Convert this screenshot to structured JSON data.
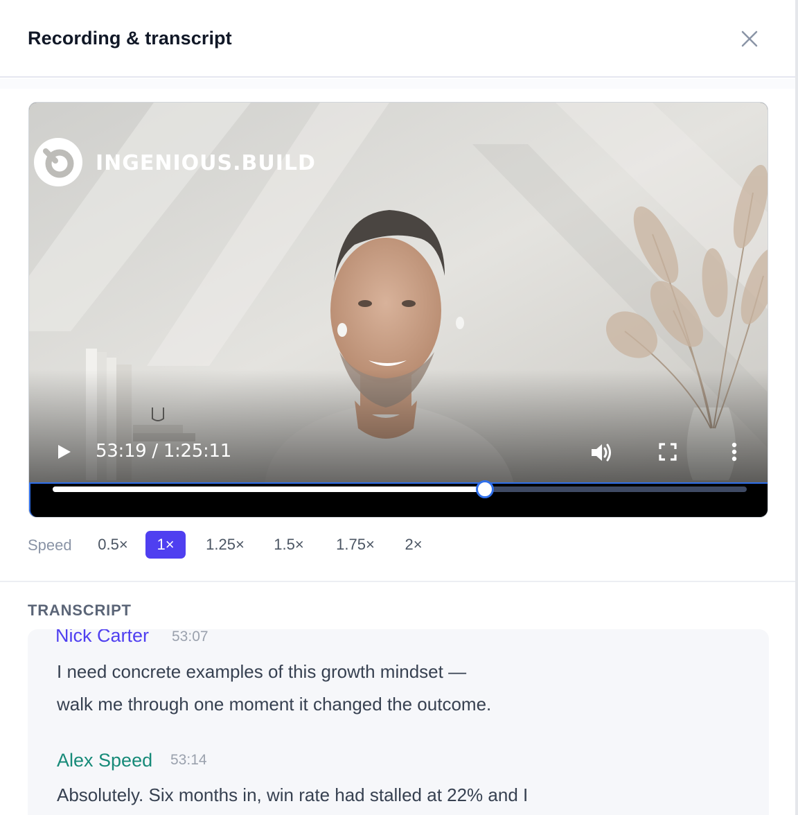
{
  "dialog": {
    "title": "Recording & transcript",
    "close_label": "close"
  },
  "player": {
    "brand_text": "INGENIOUS.BUILD",
    "current_time": "53:19",
    "duration": "1:25:11",
    "time_display": "53:19 / 1:25:11",
    "progress_fraction": 0.623,
    "is_playing": false,
    "icons": [
      "play-icon",
      "volume-icon",
      "fullscreen-icon",
      "more-vertical-icon"
    ]
  },
  "speed": {
    "label": "Speed",
    "options": [
      "0.5×",
      "1×",
      "1.25×",
      "1.5×",
      "1.75×",
      "2×"
    ],
    "selected": "1×"
  },
  "transcript": {
    "heading": "TRANSCRIPT",
    "entries": [
      {
        "speaker": "Nick Carter",
        "time": "53:07",
        "lines": [
          "I need concrete examples of this growth mindset —",
          "walk me through one moment it changed the outcome."
        ]
      },
      {
        "speaker": "Alex Speed",
        "time": "53:14",
        "lines": [
          "Absolutely. Six months in, win rate had stalled at 22% and I"
        ]
      }
    ]
  },
  "colors": {
    "accent": "#4f3ff0",
    "speaker_alt": "#168a78",
    "focus_ring": "#2f6feb"
  }
}
